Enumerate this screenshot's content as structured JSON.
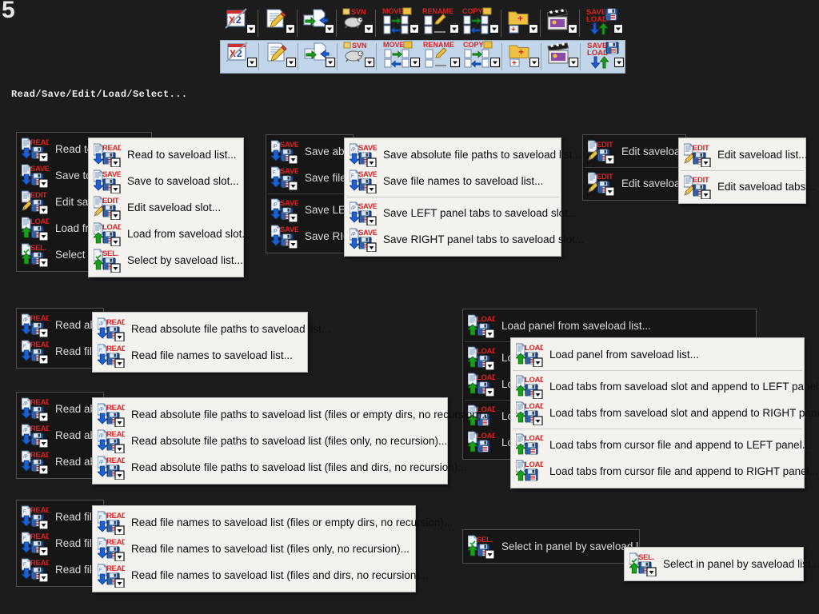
{
  "page": {
    "number": "5"
  },
  "colors": {
    "background": "#1c1c1c",
    "dark_menu_bg": "#161616",
    "light_menu_bg": "#f4f2ef",
    "toolbar_highlight": "#c3d5e8",
    "label_red": "#e02020",
    "arrow_blue": "#1b5fd0",
    "arrow_green": "#19a019",
    "text_light": "#d9d9d9",
    "text_dark": "#0d0d0d"
  },
  "section": {
    "label": "Read/Save/Edit/Load/Select..."
  },
  "toolbar": {
    "rows": [
      {
        "name": "toolbar-row-normal",
        "highlighted": false
      },
      {
        "name": "toolbar-row-hover",
        "highlighted": true
      }
    ],
    "buttons": [
      {
        "icon": "close-tabs-x2-icon",
        "label": "X2"
      },
      {
        "icon": "edit-document-pencil-icon",
        "label": ""
      },
      {
        "icon": "move-page-arrow-icon",
        "label": ""
      },
      {
        "icon": "svn-tortoise-icon",
        "label": "SVN"
      },
      {
        "icon": "move-files-icon",
        "label": "MOVE"
      },
      {
        "icon": "rename-files-icon",
        "label": "RENAME"
      },
      {
        "icon": "copy-files-icon",
        "label": "COPY"
      },
      {
        "icon": "new-folder-icon",
        "label": ""
      },
      {
        "icon": "media-clapper-icon",
        "label": ""
      },
      {
        "icon": "save-load-icon",
        "label": "SAVE LOAD"
      }
    ]
  },
  "menus": {
    "root": {
      "name": "saveload-root-menu",
      "items": [
        {
          "label": "Read to saveload list...",
          "icon": "read-saveload-icon",
          "tag": "READ",
          "arrow": "down",
          "doc": "plain",
          "submenu": true
        },
        {
          "label": "Save to saveload slot...",
          "icon": "save-saveload-icon",
          "tag": "SAVE",
          "arrow": "down",
          "doc": "plain",
          "submenu": true
        },
        {
          "label": "Edit saveload slot...",
          "icon": "edit-saveload-icon",
          "tag": "EDIT",
          "arrow": "pencil",
          "doc": "plain",
          "submenu": true
        },
        {
          "label": "Load from saveload slot...",
          "icon": "load-saveload-icon",
          "tag": "LOAD",
          "arrow": "up",
          "doc": "plain",
          "submenu": true
        },
        {
          "label": "Select by saveload list...",
          "icon": "select-saveload-icon",
          "tag": "SEL.",
          "arrow": "up",
          "doc": "check",
          "submenu": true
        }
      ]
    },
    "root_hover": {
      "name": "saveload-root-menu-expanded",
      "items": [
        {
          "label": "Read to saveload list...",
          "tag": "READ",
          "arrow": "down",
          "doc": "plain",
          "submenu": true
        },
        {
          "label": "Save to saveload slot...",
          "tag": "SAVE",
          "arrow": "down",
          "doc": "plain",
          "submenu": true
        },
        {
          "label": "Edit saveload slot...",
          "tag": "EDIT",
          "arrow": "pencil",
          "doc": "plain",
          "submenu": true
        },
        {
          "label": "Load from saveload slot...",
          "tag": "LOAD",
          "arrow": "up",
          "doc": "plain",
          "submenu": true
        },
        {
          "label": "Select by saveload list...",
          "tag": "SEL.",
          "arrow": "up",
          "doc": "check",
          "submenu": true
        }
      ]
    },
    "save_dark": {
      "name": "save-submenu-dark",
      "items": [
        {
          "label": "Save absol",
          "tag": "SAVE",
          "arrow": "down",
          "doc": "path",
          "submenu": true
        },
        {
          "label": "Save file na",
          "tag": "SAVE",
          "arrow": "down",
          "doc": "file",
          "submenu": true
        },
        {
          "separator": true
        },
        {
          "label": "Save LEFT p",
          "tag": "SAVE",
          "arrow": "down",
          "doc": "path",
          "submenu": true
        },
        {
          "label": "Save RIGHT",
          "tag": "SAVE",
          "arrow": "down",
          "doc": "path",
          "submenu": true
        }
      ]
    },
    "save_light": {
      "name": "save-submenu-light",
      "items": [
        {
          "label": "Save absolute file paths to saveload list...",
          "tag": "SAVE",
          "arrow": "down",
          "doc": "path",
          "submenu": true
        },
        {
          "label": "Save file names to saveload list...",
          "tag": "SAVE",
          "arrow": "down",
          "doc": "file",
          "submenu": true
        },
        {
          "separator": true
        },
        {
          "label": "Save LEFT panel tabs to saveload slot...",
          "tag": "SAVE",
          "arrow": "down",
          "doc": "path",
          "submenu": true
        },
        {
          "label": "Save RIGHT panel tabs to saveload slot...",
          "tag": "SAVE",
          "arrow": "down",
          "doc": "path",
          "submenu": true
        }
      ]
    },
    "edit_dark": {
      "name": "edit-submenu-dark",
      "items": [
        {
          "label": "Edit saveload",
          "tag": "EDIT",
          "arrow": "pencil",
          "doc": "plain",
          "submenu": true
        },
        {
          "separator": true
        },
        {
          "label": "Edit saveload t",
          "tag": "EDIT",
          "arrow": "pencil",
          "doc": "plain",
          "submenu": true
        }
      ]
    },
    "edit_light": {
      "name": "edit-submenu-light",
      "items": [
        {
          "label": "Edit saveload list...",
          "tag": "EDIT",
          "arrow": "pencil",
          "doc": "plain",
          "submenu": true
        },
        {
          "separator": true
        },
        {
          "label": "Edit saveload tabs...",
          "tag": "EDIT",
          "arrow": "pencil",
          "doc": "plain",
          "submenu": true
        }
      ]
    },
    "read_dark": {
      "name": "read-submenu-dark",
      "items": [
        {
          "label": "Read abs",
          "tag": "READ",
          "arrow": "down",
          "doc": "path",
          "submenu": true
        },
        {
          "label": "Read file",
          "tag": "READ",
          "arrow": "down",
          "doc": "file",
          "submenu": true
        }
      ]
    },
    "read_light": {
      "name": "read-submenu-light",
      "items": [
        {
          "label": "Read absolute file paths to saveload list...",
          "tag": "READ",
          "arrow": "down",
          "doc": "path",
          "submenu": true
        },
        {
          "label": "Read file names to saveload list...",
          "tag": "READ",
          "arrow": "down",
          "doc": "file",
          "submenu": true
        }
      ]
    },
    "readpaths_dark": {
      "name": "read-paths-submenu-dark",
      "items": [
        {
          "label": "Read abs",
          "tag": "READ",
          "arrow": "down",
          "doc": "path",
          "submenu": true
        },
        {
          "label": "Read abs",
          "tag": "READ",
          "arrow": "down",
          "doc": "path",
          "submenu": true
        },
        {
          "label": "Read abs",
          "tag": "READ",
          "arrow": "down",
          "doc": "path",
          "submenu": true
        }
      ]
    },
    "readpaths_light": {
      "name": "read-paths-submenu-light",
      "items": [
        {
          "label": "Read absolute file paths to saveload list (files or empty dirs, no recursion)...",
          "tag": "READ",
          "arrow": "down",
          "doc": "path",
          "submenu": true
        },
        {
          "label": "Read absolute file paths to saveload list (files only, no recursion)...",
          "tag": "READ",
          "arrow": "down",
          "doc": "path",
          "submenu": true
        },
        {
          "label": "Read absolute file paths to saveload list (files and dirs, no recursion)...",
          "tag": "READ",
          "arrow": "down",
          "doc": "path",
          "submenu": true
        }
      ]
    },
    "readnames_dark": {
      "name": "read-names-submenu-dark",
      "items": [
        {
          "label": "Read file",
          "tag": "READ",
          "arrow": "down",
          "doc": "file",
          "submenu": true
        },
        {
          "label": "Read file",
          "tag": "READ",
          "arrow": "down",
          "doc": "file",
          "submenu": true
        },
        {
          "label": "Read file",
          "tag": "READ",
          "arrow": "down",
          "doc": "file",
          "submenu": true
        }
      ]
    },
    "readnames_light": {
      "name": "read-names-submenu-light",
      "items": [
        {
          "label": "Read file names to saveload list (files or empty dirs, no recursion)...",
          "tag": "READ",
          "arrow": "down",
          "doc": "file",
          "submenu": true
        },
        {
          "label": "Read file names to saveload list (files only, no recursion)...",
          "tag": "READ",
          "arrow": "down",
          "doc": "file",
          "submenu": true
        },
        {
          "label": "Read file names to saveload list (files and dirs, no recursion)...",
          "tag": "READ",
          "arrow": "down",
          "doc": "file",
          "submenu": true
        }
      ]
    },
    "load_dark": {
      "name": "load-submenu-dark",
      "items": [
        {
          "label": "Load panel from saveload list...",
          "tag": "LOAD",
          "arrow": "up",
          "doc": "plain",
          "submenu": true
        },
        {
          "separator": true
        },
        {
          "label": "Loa",
          "tag": "LOAD",
          "arrow": "up",
          "doc": "plain",
          "submenu": true
        },
        {
          "label": "Loa",
          "tag": "LOAD",
          "arrow": "up",
          "doc": "plain",
          "submenu": true
        },
        {
          "separator": true
        },
        {
          "label": "Loa",
          "tag": "LOAD",
          "arrow": "up",
          "doc": "plain",
          "submenu": false
        },
        {
          "label": "Loa",
          "tag": "LOAD",
          "arrow": "up",
          "doc": "plain",
          "submenu": false
        }
      ]
    },
    "load_light": {
      "name": "load-submenu-light",
      "items": [
        {
          "label": "Load panel from saveload list...",
          "tag": "LOAD",
          "arrow": "up",
          "doc": "plain",
          "submenu": true
        },
        {
          "separator": true
        },
        {
          "label": "Load tabs from saveload slot and append to LEFT panel...",
          "tag": "LOAD",
          "arrow": "up",
          "doc": "plain",
          "submenu": true
        },
        {
          "label": "Load tabs from saveload slot and append to RIGHT panel...",
          "tag": "LOAD",
          "arrow": "up",
          "doc": "plain",
          "submenu": true
        },
        {
          "separator": true
        },
        {
          "label": "Load tabs from cursor file and append to LEFT panel...",
          "tag": "LOAD",
          "arrow": "up",
          "doc": "plain",
          "submenu": false
        },
        {
          "label": "Load tabs from cursor file and append to RIGHT panel...",
          "tag": "LOAD",
          "arrow": "up",
          "doc": "plain",
          "submenu": false
        }
      ]
    },
    "select_dark": {
      "name": "select-submenu-dark",
      "items": [
        {
          "label": "Select in panel by saveload list",
          "tag": "SEL.",
          "arrow": "up",
          "doc": "check",
          "submenu": true
        }
      ]
    },
    "select_light": {
      "name": "select-submenu-light",
      "items": [
        {
          "label": "Select in panel by saveload list...",
          "tag": "SEL.",
          "arrow": "up",
          "doc": "check",
          "submenu": true
        }
      ]
    }
  }
}
